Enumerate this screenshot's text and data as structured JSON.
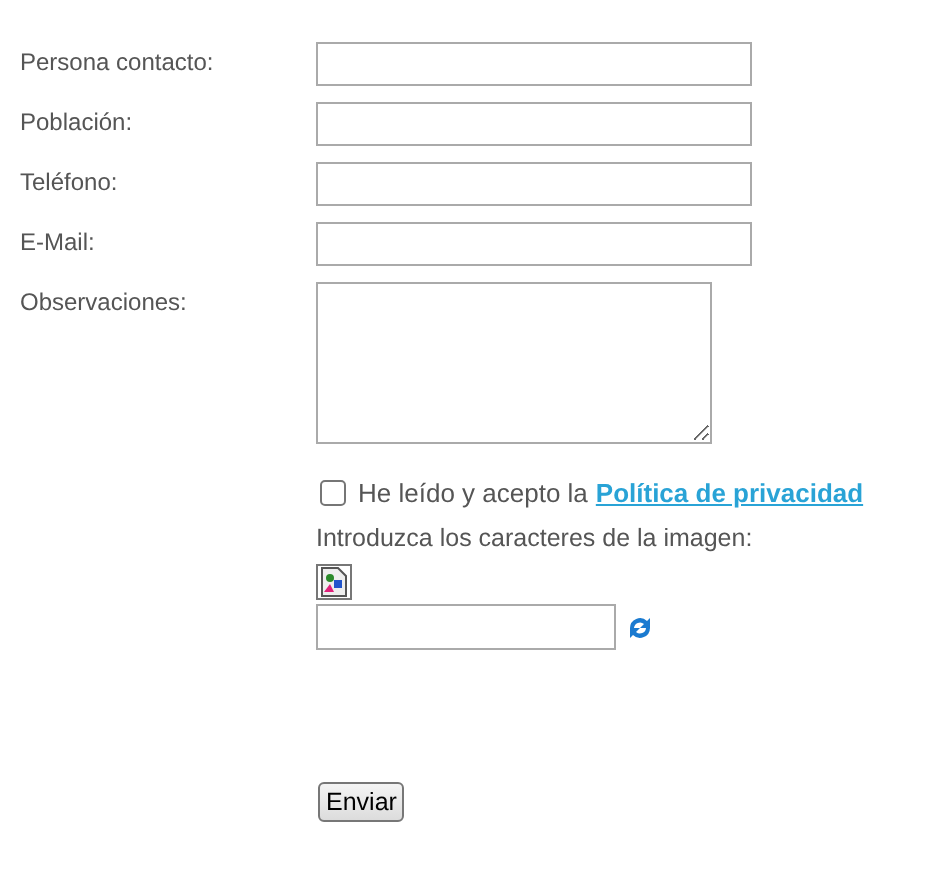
{
  "fields": [
    {
      "label": "Persona contacto:",
      "kind": "text"
    },
    {
      "label": "Población:",
      "kind": "text"
    },
    {
      "label": "Teléfono:",
      "kind": "text"
    },
    {
      "label": "E-Mail:",
      "kind": "text"
    },
    {
      "label": "Observaciones:",
      "kind": "textarea"
    }
  ],
  "privacy": {
    "checked": false,
    "text": "He leído y acepto la",
    "link": "Política de privacidad"
  },
  "captcha": {
    "prompt": "Introduzca los caracteres de la imagen:"
  },
  "submit": "Enviar"
}
